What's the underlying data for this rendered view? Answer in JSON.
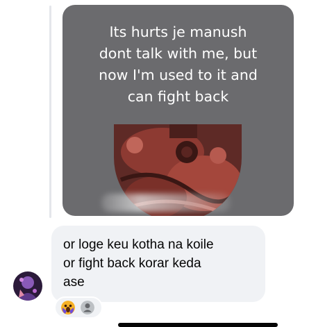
{
  "shared_post": {
    "lines": [
      "Its hurts je manush",
      "dont talk with me, but",
      "now I'm used to it and",
      "can fight back"
    ]
  },
  "message": {
    "lines": [
      "or loge keu kotha na koile",
      "or fight back korar keda",
      "ase"
    ]
  },
  "reactions": [
    {
      "icon": "wow-reaction-icon"
    },
    {
      "icon": "person-icon"
    }
  ],
  "colors": {
    "card_background": "#6b6b6e",
    "bubble_background": "#f0f2f5",
    "text": "#050505",
    "thread_line": "#e4e6eb"
  }
}
